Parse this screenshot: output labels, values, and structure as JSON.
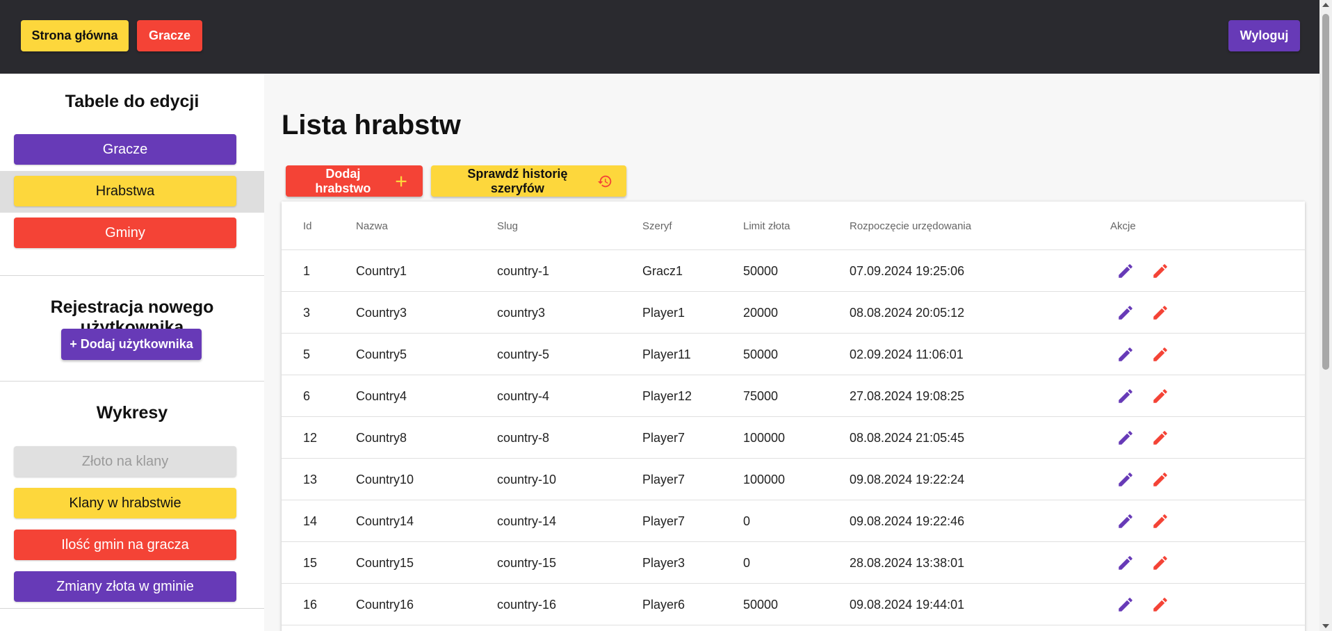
{
  "colors": {
    "topbar": "#2a2a2f",
    "yellow": "#fdd73c",
    "red": "#f44336",
    "purple": "#673ab7",
    "grey": "#e0e0e0"
  },
  "topbar": {
    "home_label": "Strona główna",
    "players_label": "Gracze",
    "logout_label": "Wyloguj"
  },
  "sidebar": {
    "tables_title": "Tabele do edycji",
    "tables": [
      {
        "label": "Gracze"
      },
      {
        "label": "Hrabstwa"
      },
      {
        "label": "Gminy"
      }
    ],
    "register_title": "Rejestracja nowego użytkownika",
    "add_user_label": "+ Dodaj użytkownika",
    "charts_title": "Wykresy",
    "charts": [
      {
        "label": "Złoto na klany"
      },
      {
        "label": "Klany w hrabstwie"
      },
      {
        "label": "Ilość gmin na gracza"
      },
      {
        "label": "Zmiany złota w gminie"
      }
    ]
  },
  "main": {
    "title": "Lista hrabstw",
    "add_label": "Dodaj hrabstwo",
    "history_label": "Sprawdź historię szeryfów",
    "columns": [
      "Id",
      "Nazwa",
      "Slug",
      "Szeryf",
      "Limit złota",
      "Rozpoczęcie urzędowania",
      "Akcje"
    ],
    "rows": [
      {
        "id": "1",
        "name": "Country1",
        "slug": "country-1",
        "sheriff": "Gracz1",
        "limit": "50000",
        "start": "07.09.2024 19:25:06"
      },
      {
        "id": "3",
        "name": "Country3",
        "slug": "country3",
        "sheriff": "Player1",
        "limit": "20000",
        "start": "08.08.2024 20:05:12"
      },
      {
        "id": "5",
        "name": "Country5",
        "slug": "country-5",
        "sheriff": "Player11",
        "limit": "50000",
        "start": "02.09.2024 11:06:01"
      },
      {
        "id": "6",
        "name": "Country4",
        "slug": "country-4",
        "sheriff": "Player12",
        "limit": "75000",
        "start": "27.08.2024 19:08:25"
      },
      {
        "id": "12",
        "name": "Country8",
        "slug": "country-8",
        "sheriff": "Player7",
        "limit": "100000",
        "start": "08.08.2024 21:05:45"
      },
      {
        "id": "13",
        "name": "Country10",
        "slug": "country-10",
        "sheriff": "Player7",
        "limit": "100000",
        "start": "09.08.2024 19:22:24"
      },
      {
        "id": "14",
        "name": "Country14",
        "slug": "country-14",
        "sheriff": "Player7",
        "limit": "0",
        "start": "09.08.2024 19:22:46"
      },
      {
        "id": "15",
        "name": "Country15",
        "slug": "country-15",
        "sheriff": "Player3",
        "limit": "0",
        "start": "28.08.2024 13:38:01"
      },
      {
        "id": "16",
        "name": "Country16",
        "slug": "country-16",
        "sheriff": "Player6",
        "limit": "50000",
        "start": "09.08.2024 19:44:01"
      }
    ]
  }
}
